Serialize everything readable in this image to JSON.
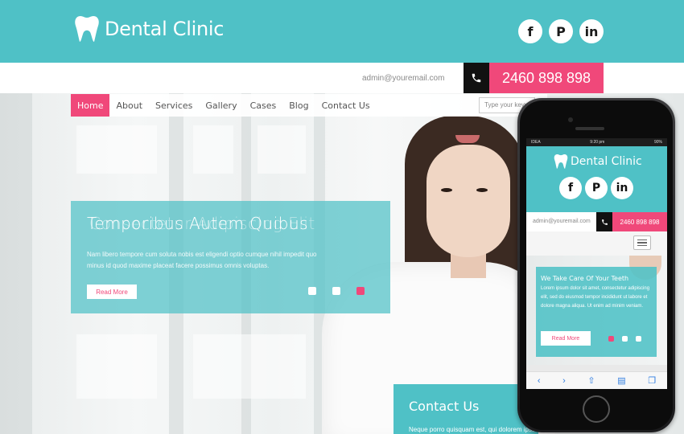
{
  "header": {
    "logo_text": "Dental Clinic",
    "social": [
      {
        "icon": "facebook-icon",
        "glyph": "f"
      },
      {
        "icon": "pinterest-icon",
        "glyph": "P"
      },
      {
        "icon": "linkedin-icon",
        "glyph": "in"
      }
    ],
    "email": "admin@youremail.com",
    "phone": "2460 898 898"
  },
  "nav": {
    "items": [
      "Home",
      "About",
      "Services",
      "Gallery",
      "Cases",
      "Blog",
      "Contact Us"
    ],
    "active": "Home",
    "search_placeholder": "Type your keyw"
  },
  "slider": {
    "title": "Temporibus Autem Quibus",
    "title_ghost": "Consectetur Adipiscing Elit",
    "text_line1": "Nam libero tempore cum soluta nobis est eligendi optio cumque nihil impedit quo",
    "text_line2": "minus id quod maxime placeat facere possimus omnis voluptas.",
    "read_more": "Read More"
  },
  "contact_panel": {
    "title": "Contact Us",
    "text": "Neque porro quisquam est, qui dolorem ipsum quia dolor sit amet,"
  },
  "mobile": {
    "status_left": "IDEA",
    "status_time": "9:20 pm",
    "status_battery": "90%",
    "logo_text": "Dental Clinic",
    "email": "admin@youremail.com",
    "phone": "2460 898 898",
    "slide_title": "We Take Care Of Your Teeth",
    "slide_text": "Lorem ipsum dolor sit amet, consectetur adipiscing elit, sed do eiusmod tempor incididunt ut labore et dolore magna aliqua. Ut enim ad minim veniam.",
    "read_more": "Read More",
    "toolbar_icons": [
      "back-icon",
      "forward-icon",
      "share-icon",
      "bookmarks-icon",
      "tabs-icon"
    ]
  },
  "colors": {
    "teal": "#4fc1c6",
    "pink": "#f0487a",
    "dark": "#111111"
  }
}
